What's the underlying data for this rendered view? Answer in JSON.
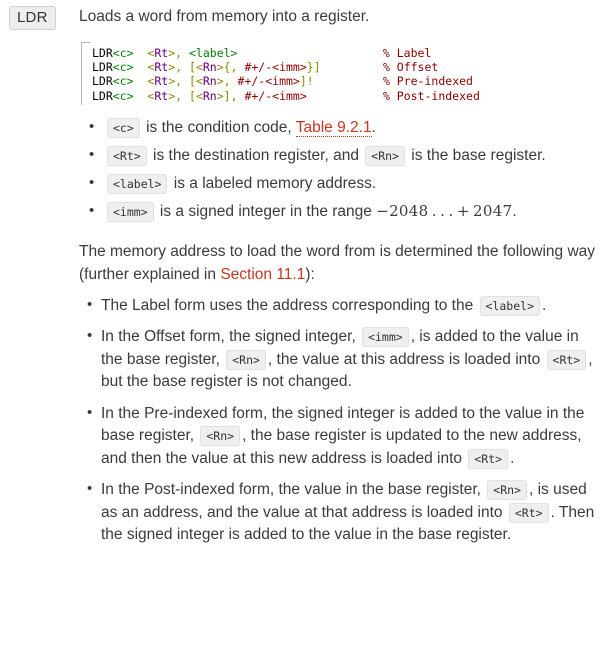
{
  "mnemonic": "LDR",
  "summary": "Loads a word from memory into a register.",
  "code_block": {
    "lines": [
      {
        "tokens": [
          {
            "t": "LDR",
            "c": "mn"
          },
          {
            "t": "<c>",
            "c": "grn"
          },
          {
            "t": "  ",
            "c": "pln"
          },
          {
            "t": "<",
            "c": "olv"
          },
          {
            "t": "Rt",
            "c": "pur"
          },
          {
            "t": ">",
            "c": "olv"
          },
          {
            "t": ", ",
            "c": "olv"
          },
          {
            "t": "<label>",
            "c": "grn"
          }
        ],
        "comment": "% Label"
      },
      {
        "tokens": [
          {
            "t": "LDR",
            "c": "mn"
          },
          {
            "t": "<c>",
            "c": "grn"
          },
          {
            "t": "  ",
            "c": "pln"
          },
          {
            "t": "<",
            "c": "olv"
          },
          {
            "t": "Rt",
            "c": "pur"
          },
          {
            "t": ">",
            "c": "olv"
          },
          {
            "t": ", [",
            "c": "olv"
          },
          {
            "t": "<",
            "c": "olv"
          },
          {
            "t": "Rn",
            "c": "pur"
          },
          {
            "t": ">",
            "c": "olv"
          },
          {
            "t": "{, ",
            "c": "olv"
          },
          {
            "t": "#+/-<imm>",
            "c": "red"
          },
          {
            "t": "}]",
            "c": "olv"
          }
        ],
        "comment": "% Offset"
      },
      {
        "tokens": [
          {
            "t": "LDR",
            "c": "mn"
          },
          {
            "t": "<c>",
            "c": "grn"
          },
          {
            "t": "  ",
            "c": "pln"
          },
          {
            "t": "<",
            "c": "olv"
          },
          {
            "t": "Rt",
            "c": "pur"
          },
          {
            "t": ">",
            "c": "olv"
          },
          {
            "t": ", [",
            "c": "olv"
          },
          {
            "t": "<",
            "c": "olv"
          },
          {
            "t": "Rn",
            "c": "pur"
          },
          {
            "t": ">",
            "c": "olv"
          },
          {
            "t": ", ",
            "c": "olv"
          },
          {
            "t": "#+/-<imm>",
            "c": "red"
          },
          {
            "t": "]!",
            "c": "olv"
          }
        ],
        "comment": "% Pre-indexed"
      },
      {
        "tokens": [
          {
            "t": "LDR",
            "c": "mn"
          },
          {
            "t": "<c>",
            "c": "grn"
          },
          {
            "t": "  ",
            "c": "pln"
          },
          {
            "t": "<",
            "c": "olv"
          },
          {
            "t": "Rt",
            "c": "pur"
          },
          {
            "t": ">",
            "c": "olv"
          },
          {
            "t": ", [",
            "c": "olv"
          },
          {
            "t": "<",
            "c": "olv"
          },
          {
            "t": "Rn",
            "c": "pur"
          },
          {
            "t": ">",
            "c": "olv"
          },
          {
            "t": "], ",
            "c": "olv"
          },
          {
            "t": "#+/-<imm>",
            "c": "red"
          }
        ],
        "comment": "% Post-indexed"
      }
    ]
  },
  "operand_list": {
    "item_c": {
      "chip": "<c>",
      "text_before_link": " is the condition code, ",
      "link": "Table 9.2.1",
      "text_after_link": "."
    },
    "item_rt_rn": {
      "chip1": "<Rt>",
      "mid1": " is the destination register, and ",
      "chip2": "<Rn>",
      "mid2": " is the base register."
    },
    "item_label": {
      "chip": "<label>",
      "text": " is a labeled memory address."
    },
    "item_imm": {
      "chip": "<imm>",
      "text": " is a signed integer in the range ",
      "math": "−2048 . . . + 2047",
      "tail": "."
    }
  },
  "mid_paragraph": {
    "before_link": "The memory address to load the word from is determined the following way (further explained in ",
    "link": "Section 11.1",
    "after_link": "):"
  },
  "form_list": {
    "label_form": {
      "text_before": "The Label form uses the address corresponding to the ",
      "chip": "<label>",
      "text_after": "."
    },
    "offset_form": {
      "p1": "In the Offset form, the signed integer, ",
      "chip1": "<imm>",
      "p2": ", is added to the value in the base register, ",
      "chip2": "<Rn>",
      "p3": ", the value at this address is loaded into ",
      "chip3": "<Rt>",
      "p4": ", but the base register is not changed."
    },
    "pre_indexed_form": {
      "p1": "In the Pre-indexed form, the signed integer is added to the value in the base register, ",
      "chip1": "<Rn>",
      "p2": ", the base register is updated to the new address, and then the value at this new address is loaded into ",
      "chip2": "<Rt>",
      "p3": "."
    },
    "post_indexed_form": {
      "p1": "In the Post-indexed form, the value in the base register, ",
      "chip1": "<Rn>",
      "p2": ", is used as an address, and the value at that address is loaded into ",
      "chip2": "<Rt>",
      "p3": ". Then the signed integer is added to the value in the base register."
    }
  },
  "colors": {
    "body_text": "#3b3b3b",
    "link": "#cc3322",
    "chip_bg": "#efefef",
    "chip_border": "#e0e0e0",
    "badge_bg": "#eeeeee",
    "code_mnemonic": "#000000",
    "code_green": "#008000",
    "code_purple": "#6c0080",
    "code_olive": "#8a8a00",
    "code_red": "#8b0000",
    "code_rule": "#b9b9b9"
  }
}
